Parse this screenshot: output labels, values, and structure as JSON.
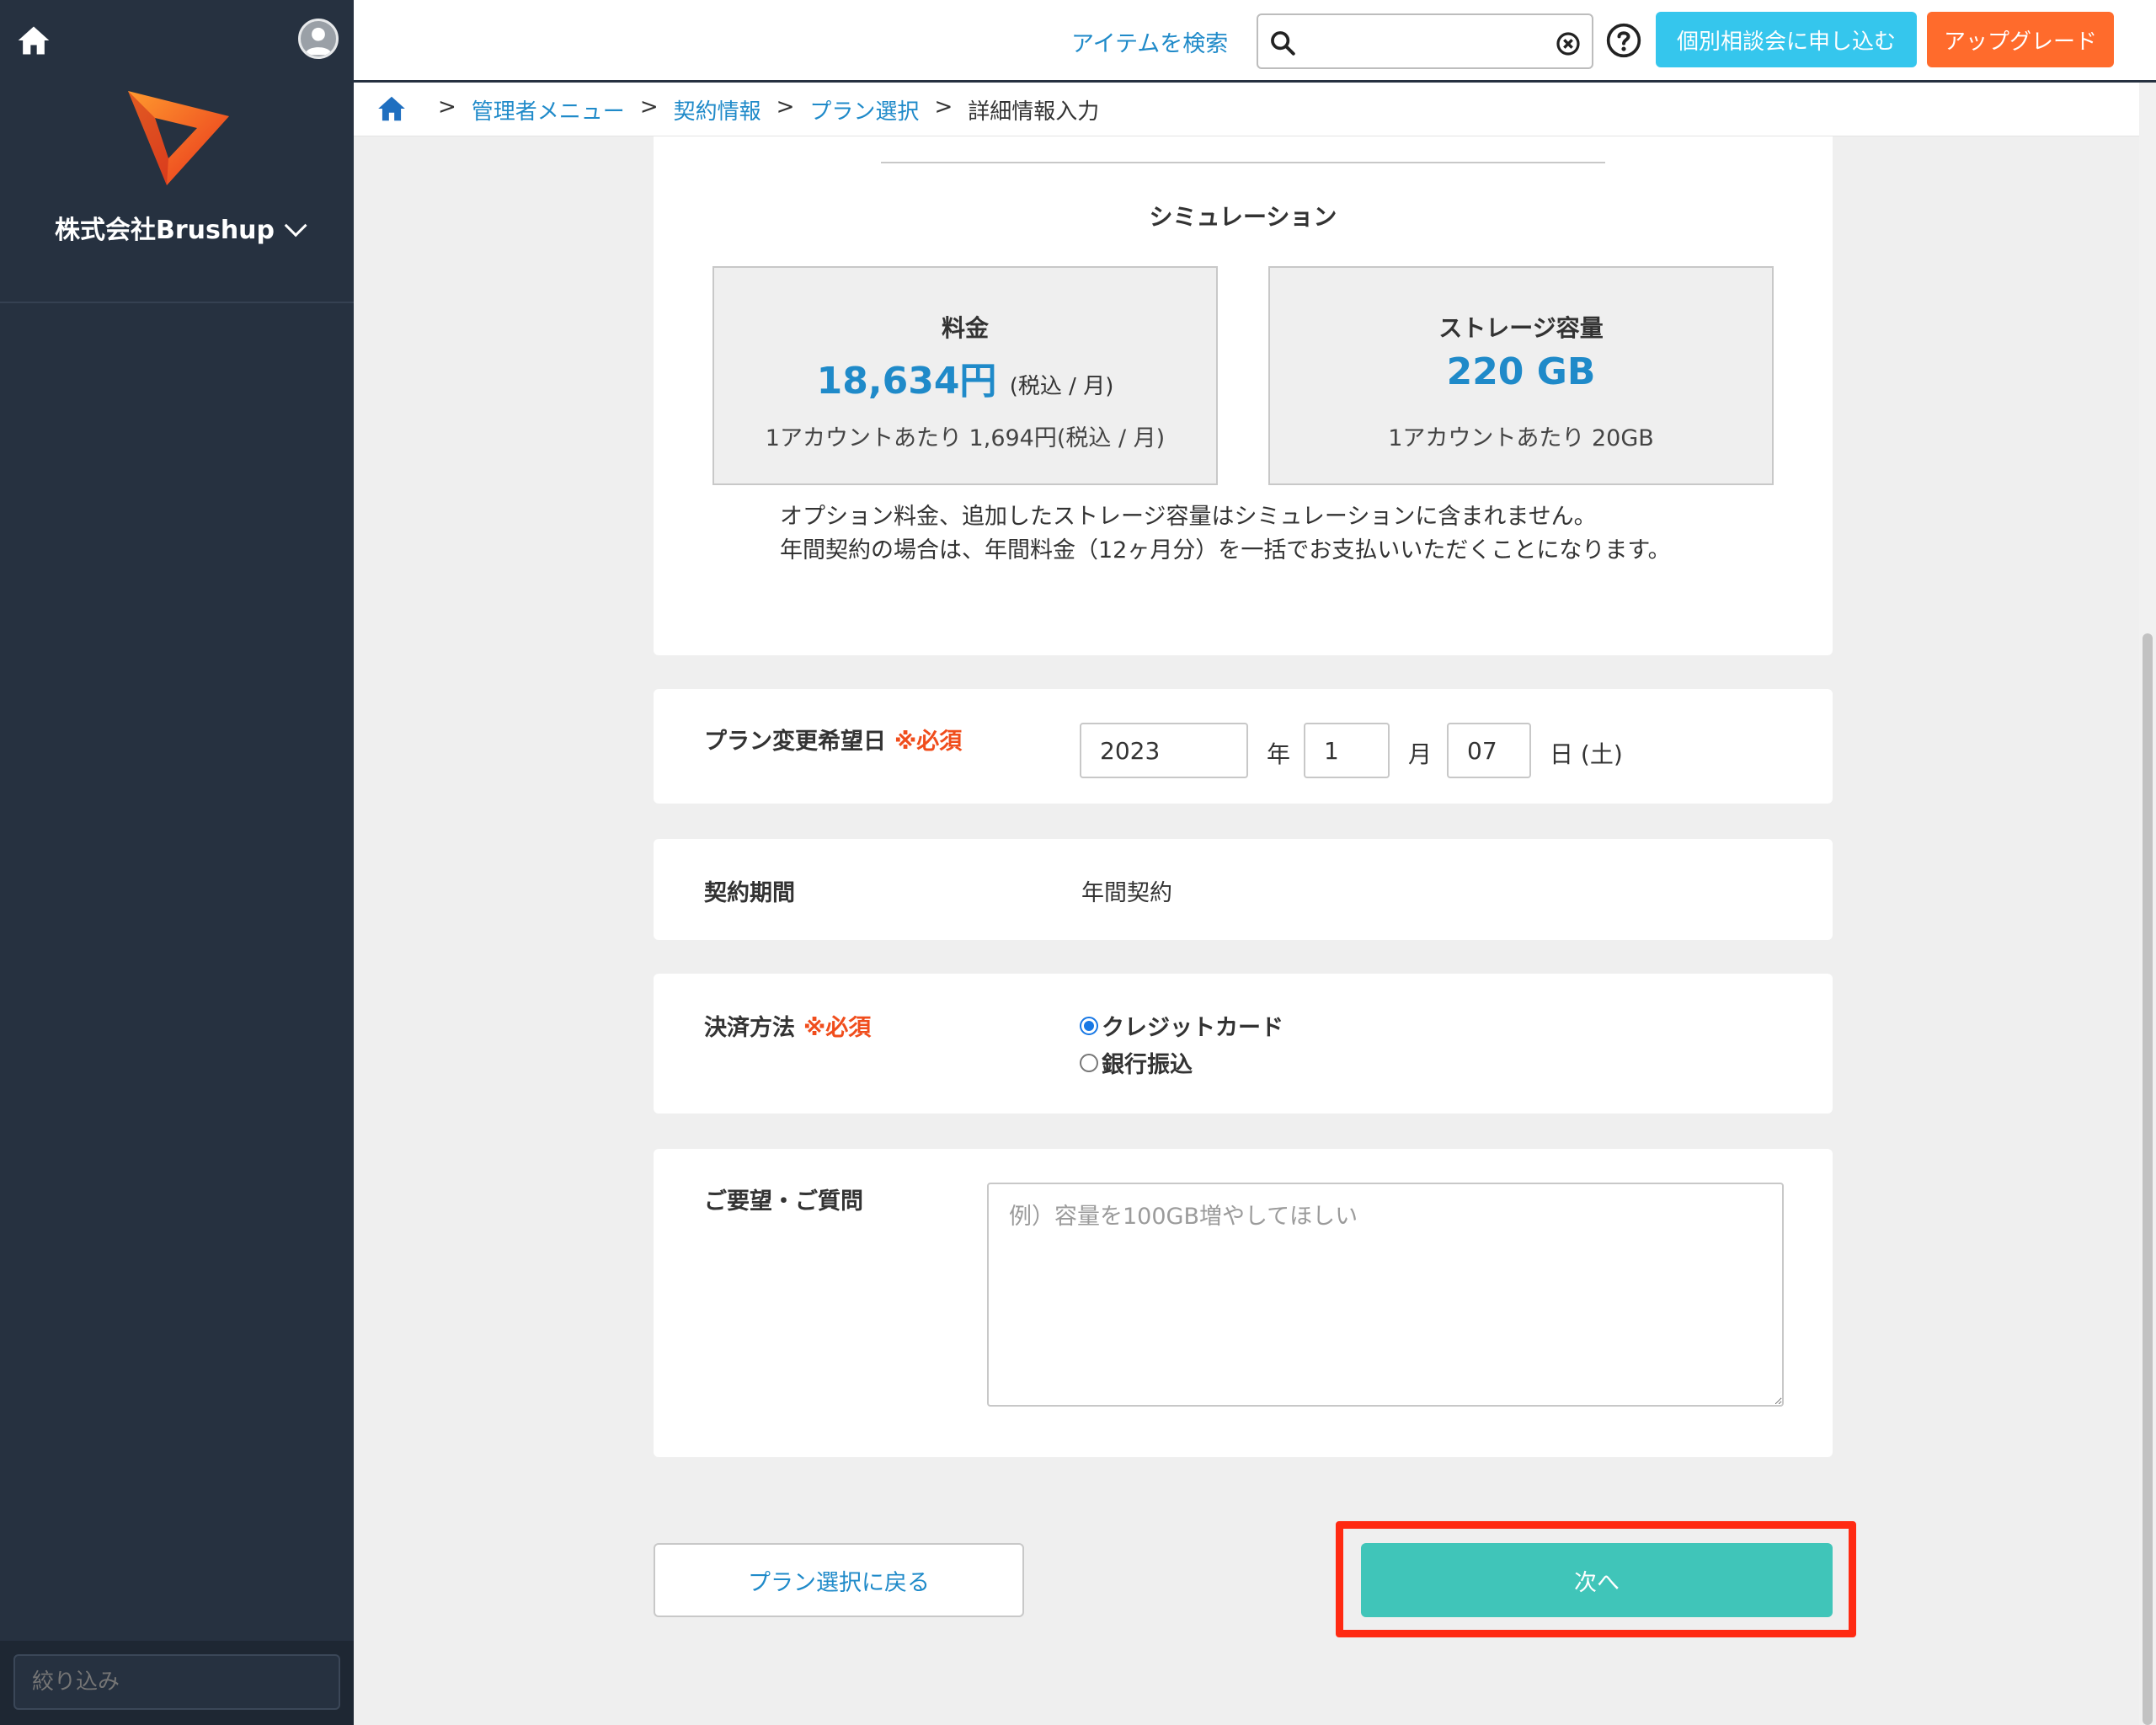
{
  "sidebar": {
    "company_name": "株式会社Brushup",
    "filter_placeholder": "絞り込み"
  },
  "header": {
    "search_label": "アイテムを検索",
    "search_value": "",
    "consult_button": "個別相談会に申し込む",
    "upgrade_button": "アップグレード"
  },
  "breadcrumb": {
    "items": [
      "管理者メニュー",
      "契約情報",
      "プラン選択"
    ],
    "current": "詳細情報入力",
    "separator": ">"
  },
  "simulation": {
    "title": "シミュレーション",
    "price": {
      "label": "料金",
      "value": "18,634円",
      "unit": "(税込 / 月)",
      "per_account": "1アカウントあたり 1,694円(税込 / 月)"
    },
    "storage": {
      "label": "ストレージ容量",
      "value": "220 GB",
      "per_account": "1アカウントあたり 20GB"
    },
    "note_line1": "オプション料金、追加したストレージ容量はシミュレーションに含まれません。",
    "note_line2": "年間契約の場合は、年間料金（12ヶ月分）を一括でお支払いいただくことになります。"
  },
  "form": {
    "required_mark": "※必須",
    "change_date": {
      "label": "プラン変更希望日",
      "year": "2023",
      "year_unit": "年",
      "month": "1",
      "month_unit": "月",
      "day": "07",
      "day_unit": "日 (土)"
    },
    "period": {
      "label": "契約期間",
      "value": "年間契約"
    },
    "payment": {
      "label": "決済方法",
      "options": [
        "クレジットカード",
        "銀行振込"
      ],
      "selected": "クレジットカード"
    },
    "request": {
      "label": "ご要望・ご質問",
      "placeholder": "例）容量を100GB増やしてほしい"
    }
  },
  "buttons": {
    "back": "プラン選択に戻る",
    "next": "次へ"
  },
  "colors": {
    "sidebar_bg": "#263140",
    "link": "#1f8ac9",
    "consult": "#35c6ed",
    "upgrade": "#ff6b2c",
    "next": "#40c5b9",
    "required": "#f04d1c",
    "highlight": "#ff2a12"
  }
}
